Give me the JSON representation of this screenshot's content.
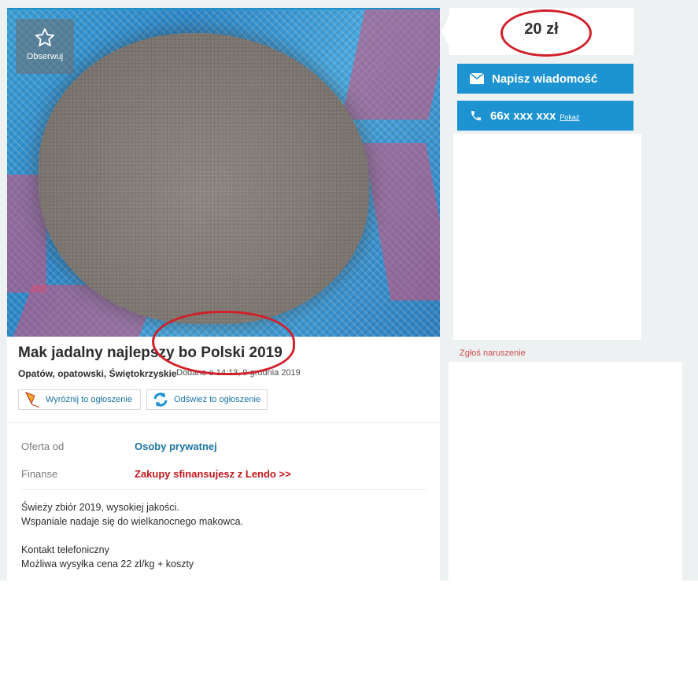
{
  "listing": {
    "observe_label": "Obserwuj",
    "title": "Mak jadalny najlepszy bo Polski 2019",
    "location": "Opatów, opatowski, Świętokrzyskie",
    "added": "Dodane o 14:13, 9 grudnia 2019",
    "actions": {
      "highlight": "Wyróżnij to ogłoszenie",
      "refresh": "Odśwież to ogłoszenie"
    },
    "details": [
      {
        "label": "Oferta od",
        "value": "Osoby prywatnej",
        "color": "#1b73a3"
      },
      {
        "label": "Finanse",
        "value": "Zakupy sfinansujesz z Lendo >>",
        "color": "#c0161c"
      }
    ],
    "description": [
      "Świeży zbiór 2019, wysokiej jakości.",
      "Wspaniale nadaje się do wielkanocnego makowca.",
      "",
      "Kontakt telefoniczny",
      "Możliwa wysyłka cena 22 zl/kg + koszty"
    ]
  },
  "sidebar": {
    "price": "20 zł",
    "message_button": "Napisz wiadomość",
    "phone": "66x xxx xxx",
    "phone_show": "Pokaż",
    "report": "Zgłoś naruszenie"
  },
  "colors": {
    "accent_blue": "#1d93d2",
    "annotation_red": "#d0202a"
  },
  "icons": [
    "star-icon",
    "envelope-icon",
    "phone-icon",
    "kite-icon",
    "refresh-icon"
  ]
}
